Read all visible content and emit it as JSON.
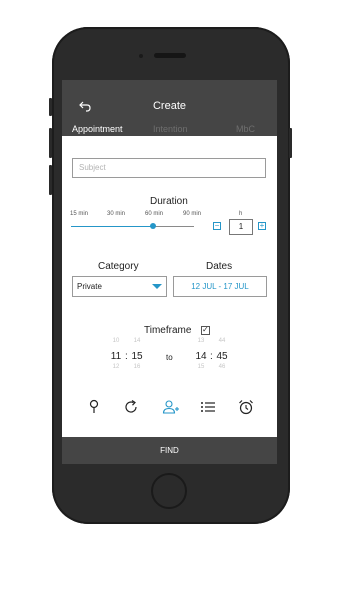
{
  "header": {
    "title": "Create",
    "tabs": [
      {
        "label": "Appointment",
        "active": true
      },
      {
        "label": "Intention",
        "active": false
      },
      {
        "label": "MbC",
        "active": false
      }
    ]
  },
  "subject": {
    "placeholder": "Subject"
  },
  "duration": {
    "label": "Duration",
    "ticks": [
      "15 min",
      "30 min",
      "60 min",
      "90 min"
    ],
    "slider_value_fraction": 0.67,
    "unit_label": "h",
    "stepper_value": "1",
    "minus": "−",
    "plus": "+"
  },
  "category": {
    "label": "Category",
    "selected": "Private"
  },
  "dates": {
    "label": "Dates",
    "value": "12 JUL - 17 JUL"
  },
  "timeframe": {
    "label": "Timeframe",
    "checked": true,
    "check_mark": "✓",
    "separator": ":",
    "to_label": "to",
    "start": {
      "hour_prev": "10",
      "hour": "11",
      "hour_next": "12",
      "minute_prev": "14",
      "minute": "15",
      "minute_next": "16"
    },
    "end": {
      "hour_prev": "13",
      "hour": "14",
      "hour_next": "15",
      "minute_prev": "44",
      "minute": "45",
      "minute_next": "46"
    }
  },
  "action_icons": [
    "location-pin-icon",
    "repeat-icon",
    "add-person-icon",
    "list-icon",
    "alarm-clock-icon"
  ],
  "find_label": "FIND",
  "colors": {
    "accent": "#2596c8",
    "bar": "#454545",
    "phone": "#2b2b2b"
  }
}
